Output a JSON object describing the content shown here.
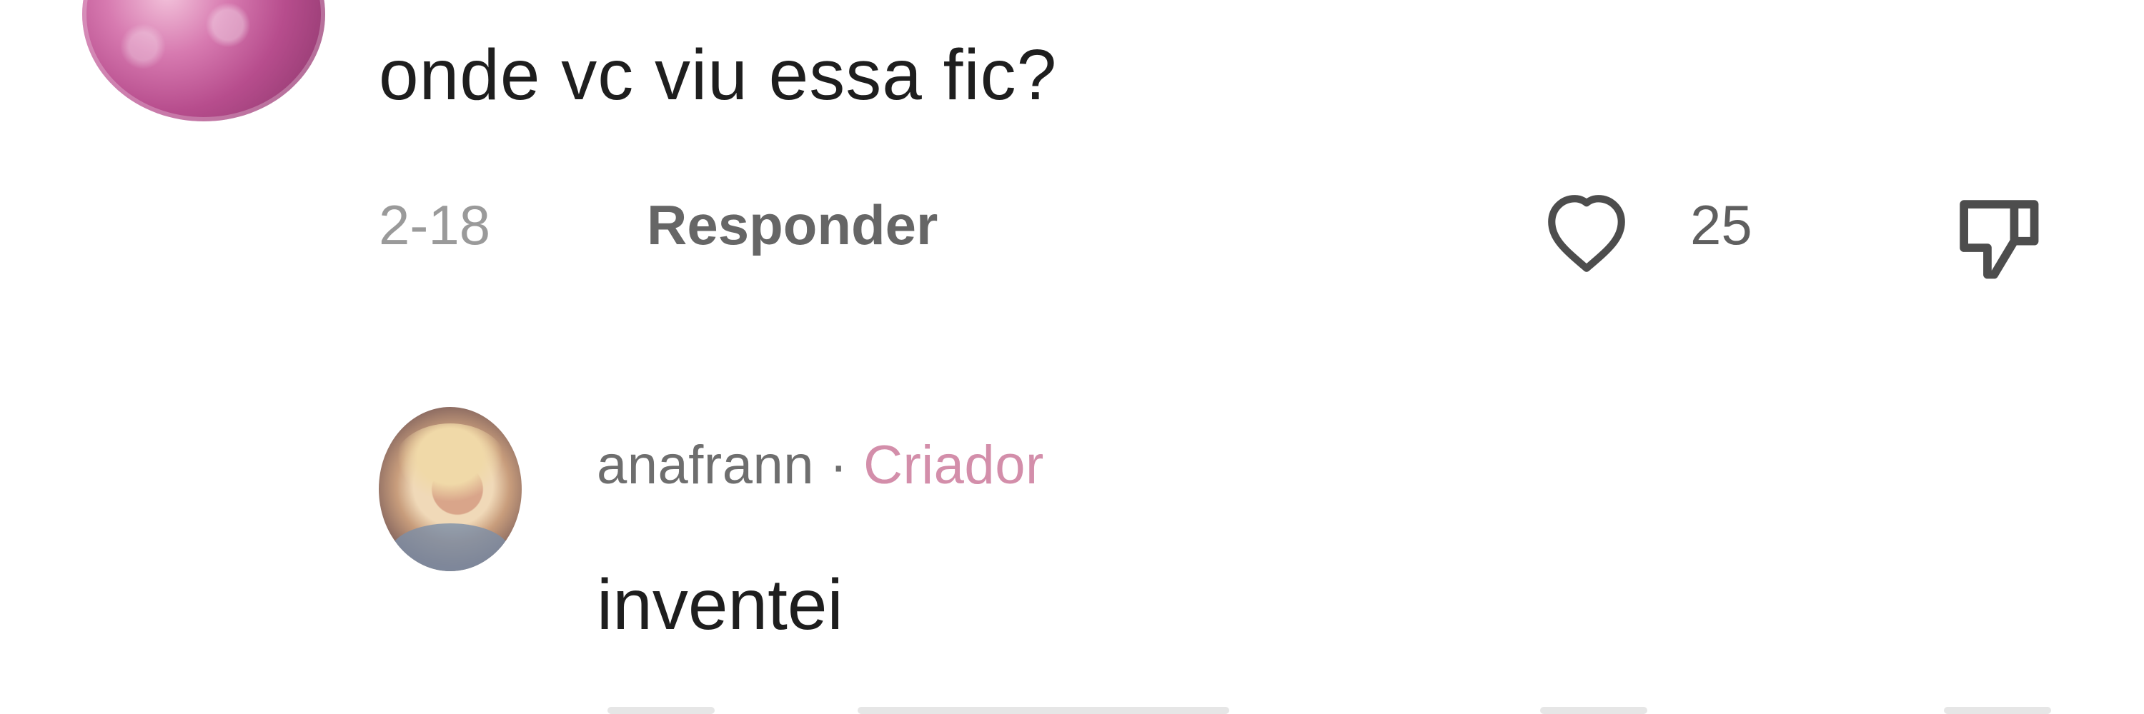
{
  "comment": {
    "text": "onde vc viu essa fic?",
    "date": "2-18",
    "reply_label": "Responder",
    "like_count": "25"
  },
  "reply": {
    "username": "anafrann",
    "separator": " · ",
    "badge": "Criador",
    "text": "inventei"
  }
}
